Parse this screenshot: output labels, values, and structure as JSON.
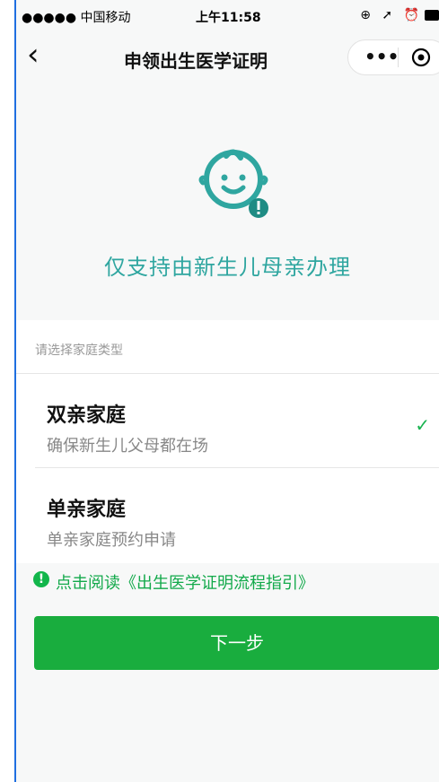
{
  "status": {
    "carrier": "●●●●● 中国移动",
    "wifi": "",
    "time": "上午11:58",
    "icons": "⊕ ➚ ⏰"
  },
  "nav": {
    "back_icon": "‹",
    "title": "申领出生医学证明",
    "more_icon": "•••",
    "target_icon": "◎"
  },
  "hero": {
    "text": "仅支持由新生儿母亲办理"
  },
  "section": {
    "label": "请选择家庭类型"
  },
  "options": [
    {
      "title": "双亲家庭",
      "subtitle": "确保新生儿父母都在场",
      "selected": true
    },
    {
      "title": "单亲家庭",
      "subtitle": "单亲家庭预约申请",
      "selected": false
    }
  ],
  "notice": {
    "icon": "!",
    "text": "点击阅读《出生医学证明流程指引》"
  },
  "button": {
    "label": "下一步"
  },
  "colors": {
    "accent_teal": "#2fa6a0",
    "primary_green": "#19ad3e",
    "check_green": "#18b34f"
  }
}
